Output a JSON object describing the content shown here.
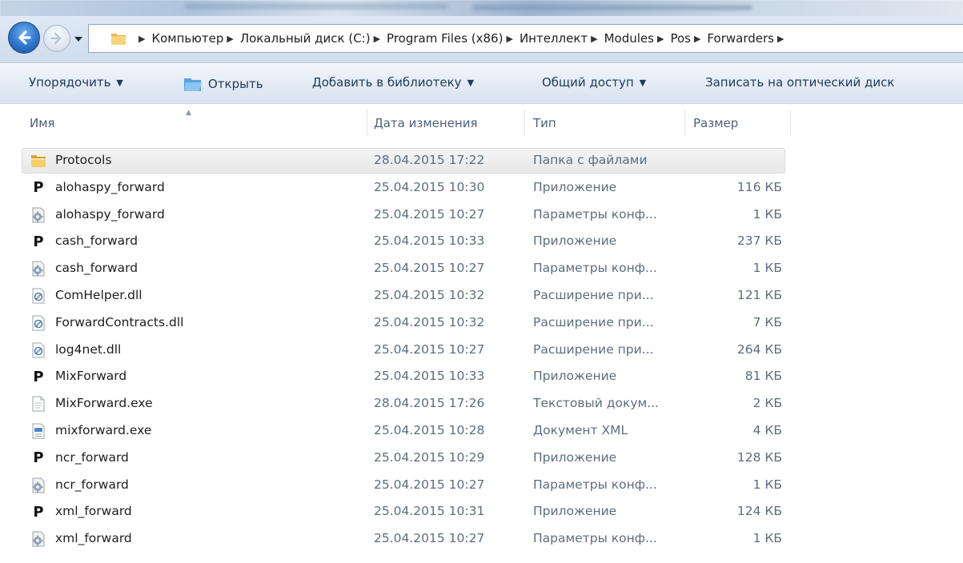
{
  "window": {
    "address_crumbs": [
      {
        "label": "Компьютер"
      },
      {
        "label": "Локальный диск (C:)"
      },
      {
        "label": "Program Files (x86)"
      },
      {
        "label": "Интеллект"
      },
      {
        "label": "Modules"
      },
      {
        "label": "Pos"
      },
      {
        "label": "Forwarders"
      }
    ]
  },
  "toolbar": {
    "organize": "Упорядочить",
    "open": "Открыть",
    "add_to_library": "Добавить в библиотеку",
    "share": "Общий доступ",
    "burn": "Записать на оптический диск"
  },
  "columns": {
    "name": "Имя",
    "date": "Дата изменения",
    "type": "Тип",
    "size": "Размер"
  },
  "files": [
    {
      "icon": "folder-icon",
      "name": "Protocols",
      "date": "28.04.2015 17:22",
      "type": "Папка с файлами",
      "size": "",
      "selected": true
    },
    {
      "icon": "application-icon",
      "name": "alohaspy_forward",
      "date": "25.04.2015 10:30",
      "type": "Приложение",
      "size": "116 КБ"
    },
    {
      "icon": "config-file-icon",
      "name": "alohaspy_forward",
      "date": "25.04.2015 10:27",
      "type": "Параметры конф...",
      "size": "1 КБ"
    },
    {
      "icon": "application-icon",
      "name": "cash_forward",
      "date": "25.04.2015 10:33",
      "type": "Приложение",
      "size": "237 КБ"
    },
    {
      "icon": "config-file-icon",
      "name": "cash_forward",
      "date": "25.04.2015 10:27",
      "type": "Параметры конф...",
      "size": "1 КБ"
    },
    {
      "icon": "dll-file-icon",
      "name": "ComHelper.dll",
      "date": "25.04.2015 10:32",
      "type": "Расширение при...",
      "size": "121 КБ"
    },
    {
      "icon": "dll-file-icon",
      "name": "ForwardContracts.dll",
      "date": "25.04.2015 10:32",
      "type": "Расширение при...",
      "size": "7 КБ"
    },
    {
      "icon": "dll-file-icon",
      "name": "log4net.dll",
      "date": "25.04.2015 10:27",
      "type": "Расширение при...",
      "size": "264 КБ"
    },
    {
      "icon": "application-icon",
      "name": "MixForward",
      "date": "25.04.2015 10:33",
      "type": "Приложение",
      "size": "81 КБ"
    },
    {
      "icon": "text-file-icon",
      "name": "MixForward.exe",
      "date": "28.04.2015 17:26",
      "type": "Текстовый докум...",
      "size": "2 КБ"
    },
    {
      "icon": "xml-file-icon",
      "name": "mixforward.exe",
      "date": "25.04.2015 10:28",
      "type": "Документ XML",
      "size": "4 КБ"
    },
    {
      "icon": "application-icon",
      "name": "ncr_forward",
      "date": "25.04.2015 10:29",
      "type": "Приложение",
      "size": "128 КБ"
    },
    {
      "icon": "config-file-icon",
      "name": "ncr_forward",
      "date": "25.04.2015 10:27",
      "type": "Параметры конф...",
      "size": "1 КБ"
    },
    {
      "icon": "application-icon",
      "name": "xml_forward",
      "date": "25.04.2015 10:31",
      "type": "Приложение",
      "size": "124 КБ"
    },
    {
      "icon": "config-file-icon",
      "name": "xml_forward",
      "date": "25.04.2015 10:27",
      "type": "Параметры конф...",
      "size": "1 КБ"
    }
  ],
  "icon_glyphs": {
    "application": "P"
  }
}
